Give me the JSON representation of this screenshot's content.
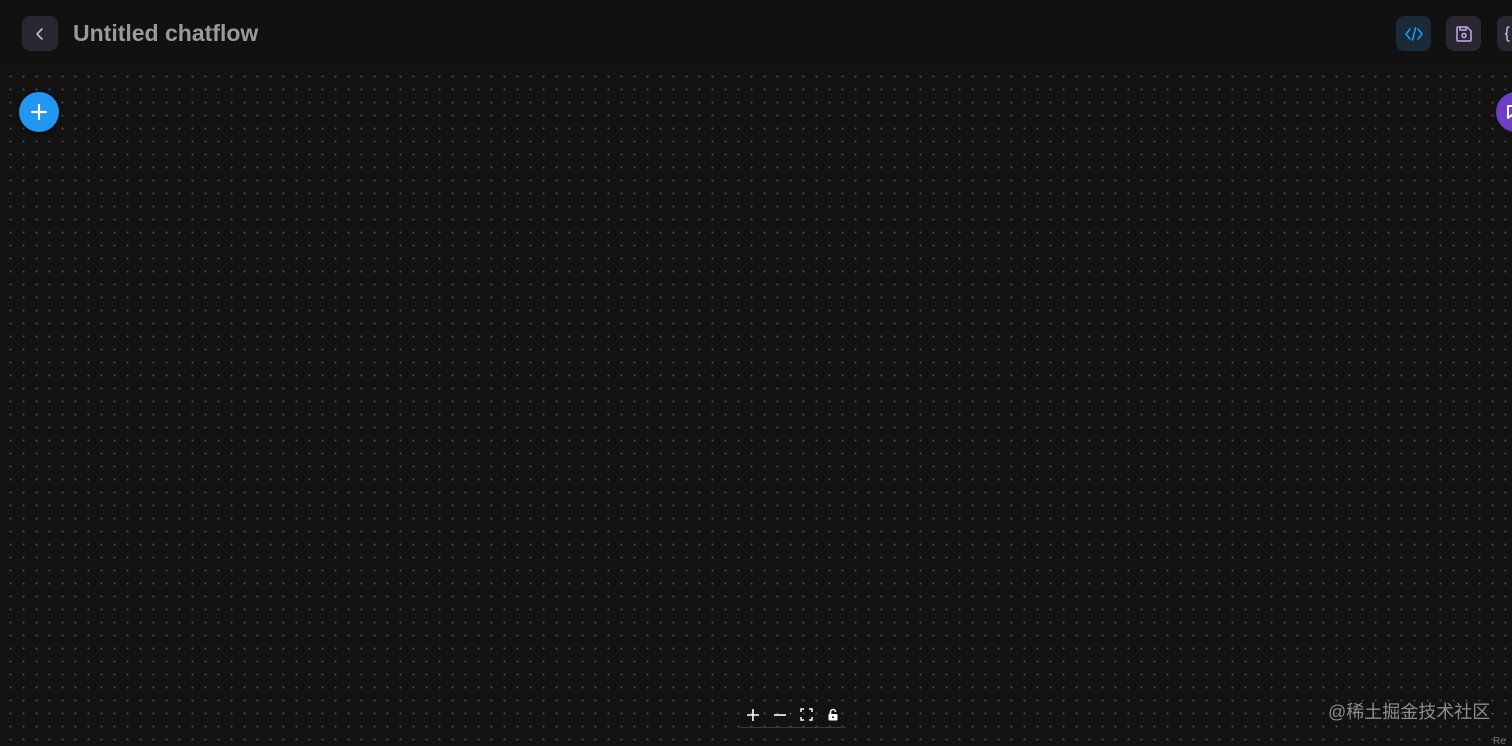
{
  "header": {
    "title": "Untitled chatflow"
  },
  "icons": {
    "back": "chevron-left-icon",
    "embed": "code-icon",
    "save": "save-icon",
    "json": "braces-icon",
    "add_node": "plus-icon",
    "chat": "chat-bubble-icon",
    "zoom_in": "plus-icon",
    "zoom_out": "minus-icon",
    "fit_view": "fullscreen-icon",
    "lock": "lock-icon"
  },
  "colors": {
    "background": "#121213",
    "accent_blue": "#2196f3",
    "accent_purple": "#6d3fc7",
    "code_icon": "#2196f3",
    "save_icon": "#c9a6f0"
  },
  "watermark": "@稀土掘金技术社区",
  "attribution": "Re"
}
